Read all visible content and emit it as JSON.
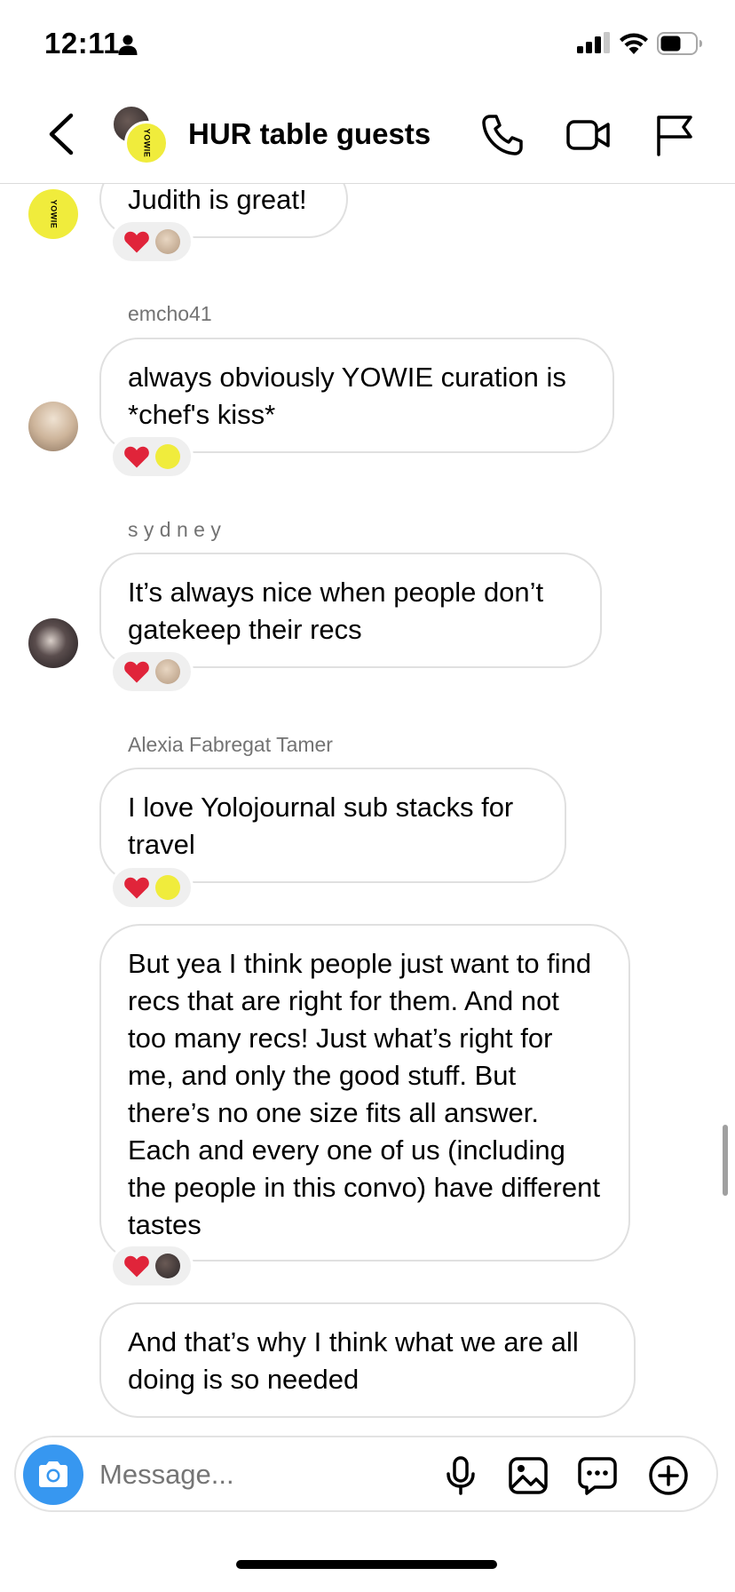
{
  "status_bar": {
    "time": "12:11"
  },
  "header": {
    "title": "HUR table guests",
    "avatar_text": "YOWIE"
  },
  "messages": [
    {
      "sender": "",
      "text": "Judith is great!",
      "reactions": [
        "heart",
        "photo"
      ]
    },
    {
      "sender": "emcho41",
      "text": "always obviously YOWIE curation is *chef's kiss*",
      "reactions": [
        "heart",
        "yowie"
      ]
    },
    {
      "sender": "s y d n e y",
      "text": "It’s always nice when people don’t gatekeep their recs",
      "reactions": [
        "heart",
        "photo"
      ]
    },
    {
      "sender": "Alexia Fabregat Tamer",
      "text": "I love Yolojournal sub stacks for travel",
      "reactions": [
        "heart",
        "yowie"
      ]
    },
    {
      "sender": "",
      "text": "But yea I think people just want to find recs that are right for them. And not too many recs! Just what’s right for me, and only the good stuff. But there’s no one size fits all answer. Each and every one of us (including the people in this convo) have different tastes",
      "reactions": [
        "heart",
        "dark"
      ]
    },
    {
      "sender": "",
      "text": "And that’s why I think what we are all doing is so needed",
      "reactions": []
    }
  ],
  "composer": {
    "placeholder": "Message..."
  },
  "colors": {
    "accent": "#3797f0",
    "yowie_yellow": "#f0ec3c",
    "heart_red": "#e0243a"
  }
}
